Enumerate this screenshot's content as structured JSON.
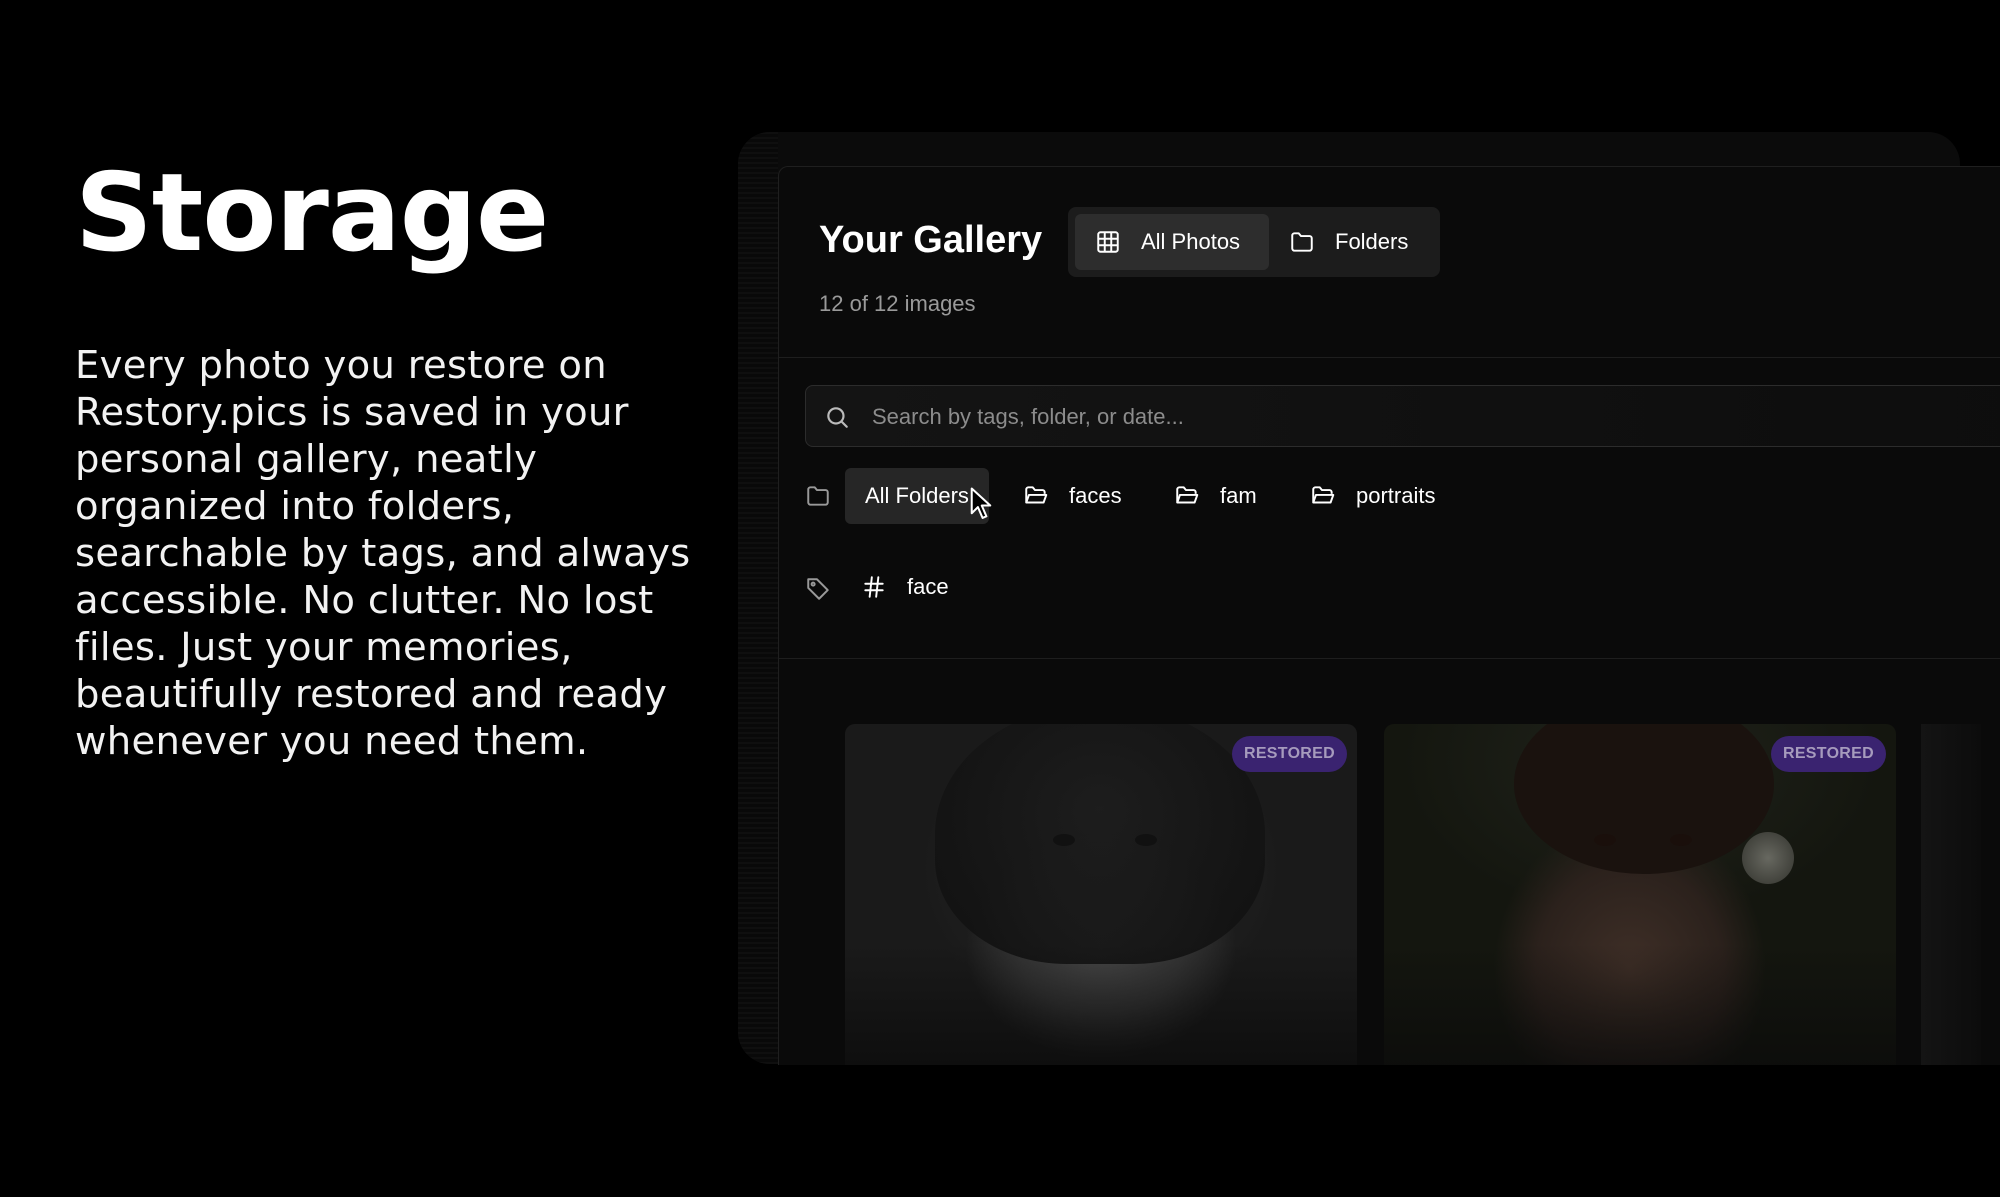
{
  "hero": {
    "title": "Storage",
    "description": "Every photo you restore on Restory.pics is saved in your personal gallery, neatly organized into folders, searchable by tags, and always accessible. No clutter. No lost files. Just your memories, beautifully restored and ready whenever you need them."
  },
  "gallery": {
    "title": "Your Gallery",
    "count_text": "12 of 12 images",
    "view_toggle": [
      {
        "label": "All Photos",
        "icon": "grid-icon",
        "active": true
      },
      {
        "label": "Folders",
        "icon": "folder-icon",
        "active": false
      }
    ],
    "search": {
      "placeholder": "Search by tags, folder, or date...",
      "value": ""
    },
    "folders": [
      {
        "label": "All Folders",
        "active": true
      },
      {
        "label": "faces",
        "active": false
      },
      {
        "label": "fam",
        "active": false
      },
      {
        "label": "portraits",
        "active": false
      }
    ],
    "tags": [
      {
        "label": "face"
      }
    ],
    "photos": [
      {
        "badge": "RESTORED"
      },
      {
        "badge": "RESTORED"
      }
    ]
  },
  "colors": {
    "background": "#000000",
    "panel": "#0a0a0a",
    "badge_bg": "#3a2370",
    "badge_text": "#a69bbd"
  }
}
